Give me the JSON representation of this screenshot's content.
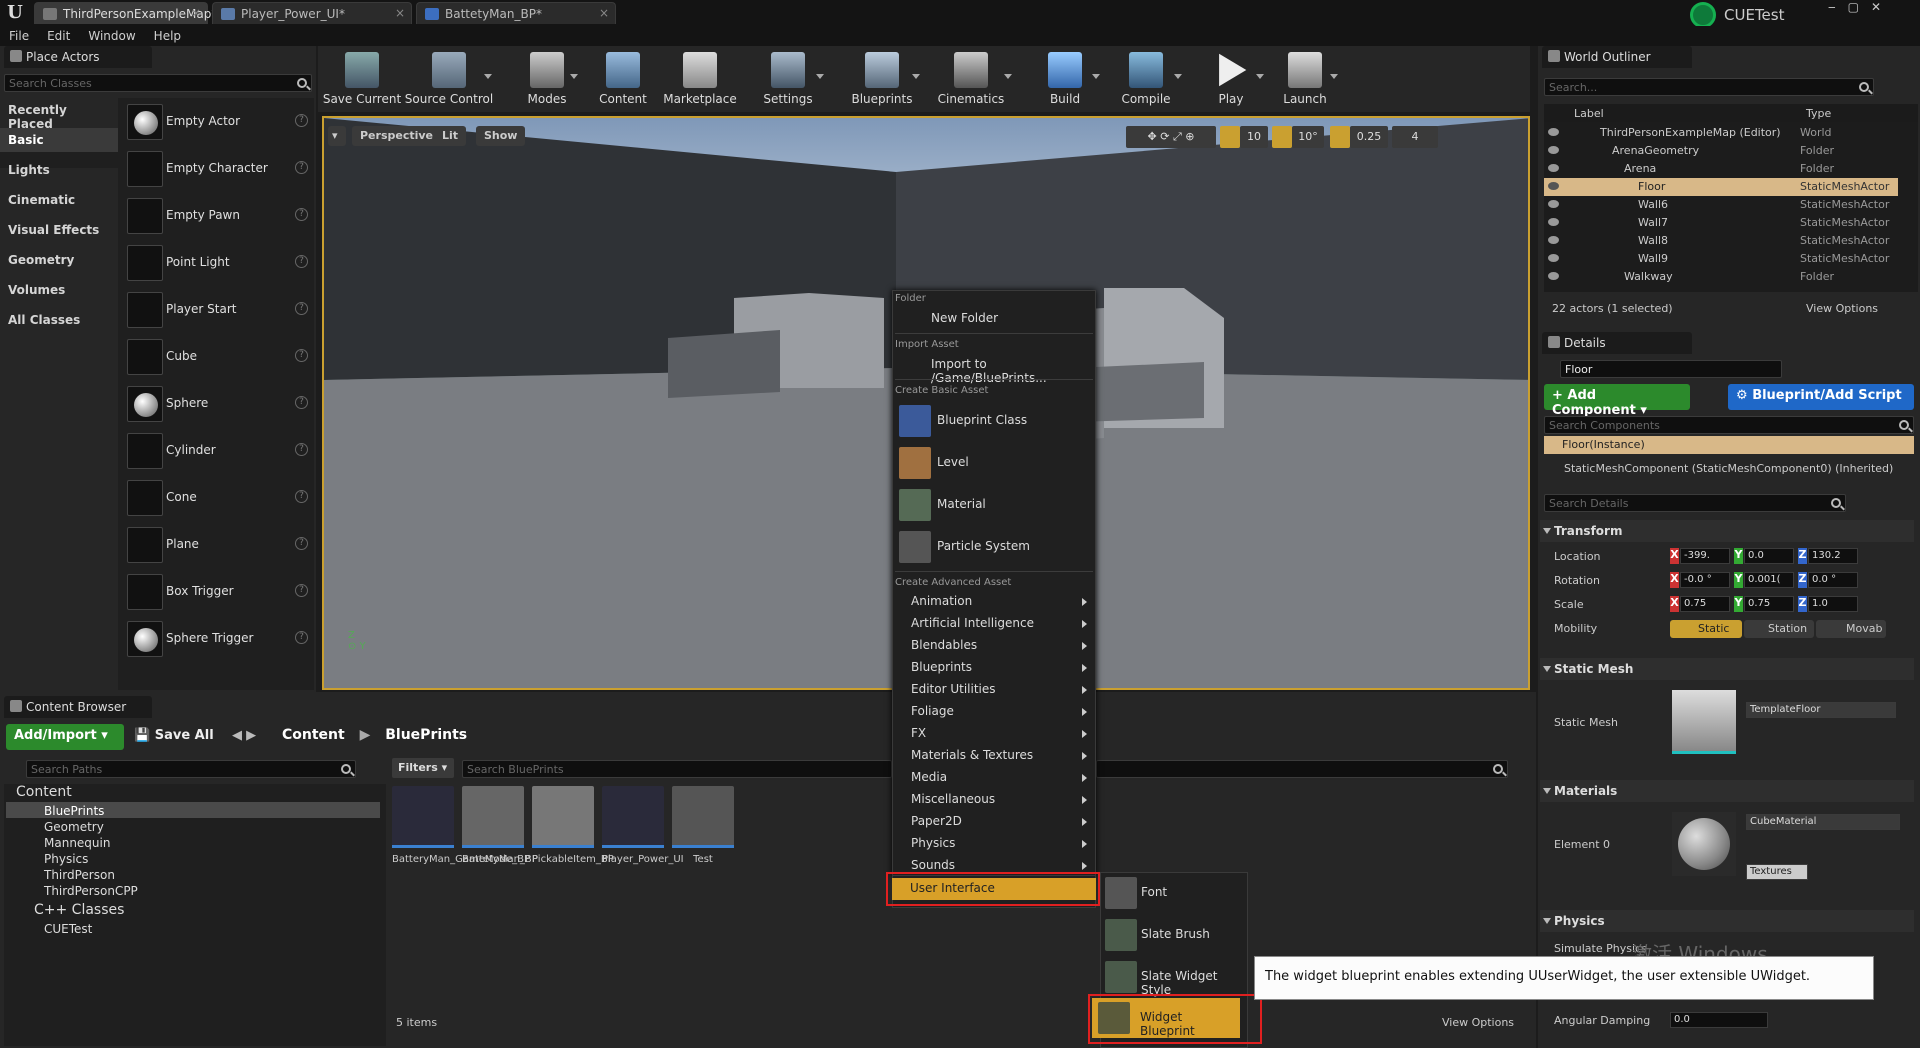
{
  "tabs": [
    {
      "label": "ThirdPersonExampleMap*"
    },
    {
      "label": "Player_Power_UI*"
    },
    {
      "label": "BattetyMan_BP*"
    }
  ],
  "menu": [
    "File",
    "Edit",
    "Window",
    "Help"
  ],
  "user": "CUETest",
  "place_actors": {
    "title": "Place Actors",
    "search_placeholder": "Search Classes",
    "categories": [
      "Recently Placed",
      "Basic",
      "Lights",
      "Cinematic",
      "Visual Effects",
      "Geometry",
      "Volumes",
      "All Classes"
    ],
    "selected_category": "Basic",
    "actors": [
      "Empty Actor",
      "Empty Character",
      "Empty Pawn",
      "Point Light",
      "Player Start",
      "Cube",
      "Sphere",
      "Cylinder",
      "Cone",
      "Plane",
      "Box Trigger",
      "Sphere Trigger"
    ]
  },
  "toolbar": [
    "Save Current",
    "Source Control",
    "Modes",
    "Content",
    "Marketplace",
    "Settings",
    "Blueprints",
    "Cinematics",
    "Build",
    "Compile",
    "Play",
    "Launch"
  ],
  "viewport": {
    "perspective": "Perspective",
    "lit": "Lit",
    "show": "Show",
    "grid": "10",
    "angle": "10°",
    "scale": "0.25",
    "camera_speed": "4"
  },
  "context_menu": {
    "folder_header": "Folder",
    "new_folder": "New Folder",
    "import_header": "Import Asset",
    "import_to": "Import to /Game/BluePrints...",
    "basic_header": "Create Basic Asset",
    "basic": [
      "Blueprint Class",
      "Level",
      "Material",
      "Particle System"
    ],
    "advanced_header": "Create Advanced Asset",
    "advanced": [
      "Animation",
      "Artificial Intelligence",
      "Blendables",
      "Blueprints",
      "Editor Utilities",
      "Foliage",
      "FX",
      "Materials & Textures",
      "Media",
      "Miscellaneous",
      "Paper2D",
      "Physics",
      "Sounds",
      "User Interface"
    ],
    "submenu": [
      "Font",
      "Slate Brush",
      "Slate Widget Style",
      "Widget Blueprint"
    ],
    "tooltip": "The widget blueprint enables extending UUserWidget, the user extensible UWidget."
  },
  "outliner": {
    "title": "World Outliner",
    "search_placeholder": "Search...",
    "col_label": "Label",
    "col_type": "Type",
    "rows": [
      {
        "label": "ThirdPersonExampleMap (Editor)",
        "type": "World"
      },
      {
        "label": "ArenaGeometry",
        "type": "Folder"
      },
      {
        "label": "Arena",
        "type": "Folder"
      },
      {
        "label": "Floor",
        "type": "StaticMeshActor"
      },
      {
        "label": "Wall6",
        "type": "StaticMeshActor"
      },
      {
        "label": "Wall7",
        "type": "StaticMeshActor"
      },
      {
        "label": "Wall8",
        "type": "StaticMeshActor"
      },
      {
        "label": "Wall9",
        "type": "StaticMeshActor"
      },
      {
        "label": "Walkway",
        "type": "Folder"
      }
    ],
    "count": "22 actors (1 selected)",
    "view_options": "View Options"
  },
  "details": {
    "title": "Details",
    "name": "Floor",
    "add_component": "Add Component",
    "blueprint_btn": "Blueprint/Add Script",
    "search_components": "Search Components",
    "instance": "Floor(Instance)",
    "component": "StaticMeshComponent (StaticMeshComponent0) (Inherited)",
    "search_details": "Search Details",
    "transform": "Transform",
    "location_label": "Location",
    "location": [
      "-399.",
      "0.0",
      "130.2"
    ],
    "rotation_label": "Rotation",
    "rotation": [
      "-0.0 °",
      "0.001(",
      "0.0 °"
    ],
    "scale_label": "Scale",
    "scale": [
      "0.75",
      "0.75",
      "1.0"
    ],
    "mobility_label": "Mobility",
    "mobility": [
      "Static",
      "Station",
      "Movab"
    ],
    "static_mesh_section": "Static Mesh",
    "static_mesh_label": "Static Mesh",
    "static_mesh_value": "TemplateFloor",
    "materials_section": "Materials",
    "element_label": "Element 0",
    "material_value": "CubeMaterial",
    "textures": "Textures",
    "physics_section": "Physics",
    "simulate_physics": "Simulate Physics",
    "angular_damping_label": "Angular Damping",
    "angular_damping": "0.0",
    "watermark": "激活 Windows"
  },
  "content_browser": {
    "title": "Content Browser",
    "add_import": "Add/Import",
    "save_all": "Save All",
    "path": [
      "Content",
      "BluePrints"
    ],
    "search_paths": "Search Paths",
    "filters": "Filters",
    "search_assets": "Search BluePrints",
    "tree": [
      "Content",
      "BluePrints",
      "Geometry",
      "Mannequin",
      "Physics",
      "ThirdPerson",
      "ThirdPersonCPP",
      "C++ Classes",
      "CUETest"
    ],
    "assets": [
      "BatteryMan_GameMode_BP",
      "BattetyMan_BP",
      "PickableItem_BP",
      "Player_Power_UI",
      "Test"
    ],
    "items_count": "5 items",
    "view_options": "View Options"
  }
}
